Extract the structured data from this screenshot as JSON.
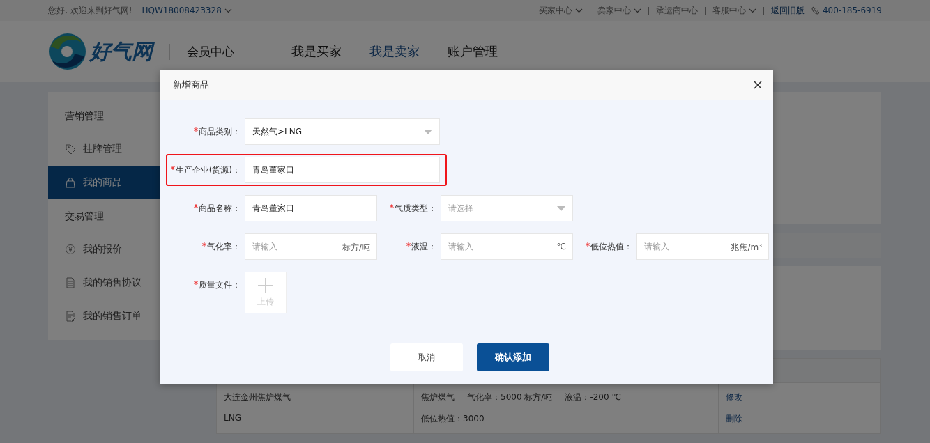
{
  "top_bar": {
    "greeting": "您好, 欢迎来到好气网!",
    "account": "HQW18008423328",
    "links": [
      {
        "label": "买家中心",
        "dropdown": true
      },
      {
        "label": "卖家中心",
        "dropdown": true
      },
      {
        "label": "承运商中心",
        "dropdown": false
      },
      {
        "label": "客服中心",
        "dropdown": true
      }
    ],
    "old_version": "返回旧版",
    "phone": "400-185-6919"
  },
  "header": {
    "logo_text": "好气网",
    "section": "会员中心",
    "nav": [
      {
        "label": "我是买家",
        "selected": false
      },
      {
        "label": "我是卖家",
        "selected": true
      },
      {
        "label": "账户管理",
        "selected": false
      }
    ]
  },
  "sidebar": {
    "groups": [
      {
        "title": "营销管理",
        "items": [
          {
            "label": "挂牌管理",
            "selected": false
          },
          {
            "label": "我的商品",
            "selected": true
          }
        ]
      },
      {
        "title": "交易管理",
        "items": [
          {
            "label": "我的报价",
            "selected": false
          },
          {
            "label": "我的销售协议",
            "selected": false
          },
          {
            "label": "我的销售订单",
            "selected": false
          }
        ]
      }
    ]
  },
  "table": {
    "rows": [
      {
        "column_1": [
          "大连金州焦炉煤气",
          "LNG"
        ],
        "column_2": [
          [
            "焦炉煤气",
            "气化率：5000 标方/吨",
            "液温：-200 ℃"
          ],
          [
            "低位热值：3000"
          ]
        ],
        "column_3": [
          "修改",
          "删除"
        ]
      }
    ]
  },
  "dialog": {
    "title": "新增商品",
    "rows": [
      {
        "highlighted": false,
        "fields": [
          {
            "kind": "select",
            "label": "商品类别：",
            "required": true,
            "value": "天然气>LNG",
            "wide": true
          }
        ]
      },
      {
        "highlighted": true,
        "fields": [
          {
            "kind": "text",
            "label": "生产企业(货源)：",
            "required": true,
            "value": "青岛董家口",
            "wide": true
          }
        ]
      },
      {
        "highlighted": false,
        "fields": [
          {
            "kind": "text",
            "label": "商品名称：",
            "required": true,
            "value": "青岛董家口",
            "wide": false
          },
          {
            "kind": "select",
            "label": "气质类型：",
            "required": true,
            "placeholder": "请选择",
            "wide": false
          }
        ]
      },
      {
        "highlighted": false,
        "fields": [
          {
            "kind": "unit",
            "label": "气化率：",
            "required": true,
            "placeholder": "请输入",
            "unit": "标方/吨",
            "wide": false
          },
          {
            "kind": "unit",
            "label": "液温：",
            "required": true,
            "placeholder": "请输入",
            "unit": "℃",
            "wide": false
          },
          {
            "kind": "unit",
            "label": "低位热值：",
            "required": true,
            "placeholder": "请输入",
            "unit": "兆焦/m³",
            "wide": false
          }
        ]
      },
      {
        "highlighted": false,
        "fields": [
          {
            "kind": "upload",
            "label": "质量文件：",
            "required": true,
            "button": "上传",
            "wide": false
          }
        ]
      }
    ],
    "buttons": [
      {
        "label": "取消",
        "kind": "secondary"
      },
      {
        "label": "确认添加",
        "kind": "primary"
      }
    ]
  }
}
